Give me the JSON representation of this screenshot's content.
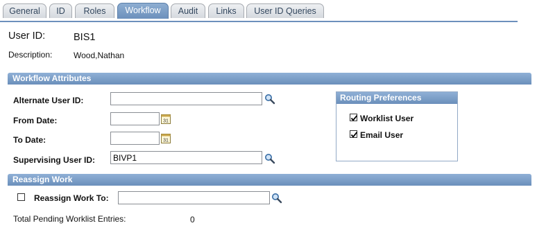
{
  "tabs": [
    {
      "label": "General",
      "active": false
    },
    {
      "label": "ID",
      "active": false
    },
    {
      "label": "Roles",
      "active": false
    },
    {
      "label": "Workflow",
      "active": true
    },
    {
      "label": "Audit",
      "active": false
    },
    {
      "label": "Links",
      "active": false
    },
    {
      "label": "User ID Queries",
      "active": false
    }
  ],
  "header": {
    "user_id_label": "User ID:",
    "user_id_value": "BIS1",
    "description_label": "Description:",
    "description_value": "Wood,Nathan"
  },
  "workflow_attributes": {
    "title": "Workflow Attributes",
    "alternate_user_id_label": "Alternate User ID:",
    "alternate_user_id_value": "",
    "from_date_label": "From Date:",
    "from_date_value": "",
    "to_date_label": "To Date:",
    "to_date_value": "",
    "supervising_user_id_label": "Supervising User ID:",
    "supervising_user_id_value": "BIVP1"
  },
  "routing_preferences": {
    "title": "Routing Preferences",
    "worklist_user_label": "Worklist User",
    "worklist_user_checked": true,
    "email_user_label": "Email User",
    "email_user_checked": true
  },
  "reassign_work": {
    "title": "Reassign Work",
    "reassign_checked": false,
    "reassign_label": "Reassign Work To:",
    "reassign_value": "",
    "pending_label": "Total Pending Worklist Entries:",
    "pending_value": "0"
  },
  "icons": {
    "lookup": "magnifier-icon",
    "calendar": "calendar-icon",
    "calendar_glyph": "31"
  },
  "colors": {
    "tab_active": "#6c90bc",
    "section_header": "#7a9cc6"
  }
}
